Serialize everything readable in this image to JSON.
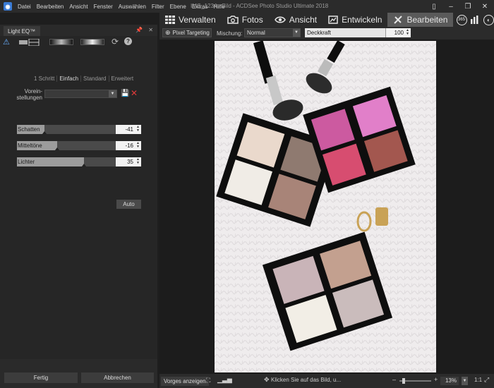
{
  "app": {
    "menu": [
      "Datei",
      "Bearbeiten",
      "Ansicht",
      "Fenster",
      "Auswählen",
      "Filter",
      "Ebene",
      "Extras",
      "Hilfe"
    ],
    "title": "IMG_1234 - Bild - ACDSee Photo Studio Ultimate 2018"
  },
  "modes": {
    "manage": "Verwalten",
    "photos": "Fotos",
    "view": "Ansicht",
    "develop": "Entwickeln",
    "edit": "Bearbeiten",
    "badge": "365"
  },
  "panel": {
    "tab_title": "Light EQ™",
    "mode_tabs": [
      "1 Schritt",
      "Einfach",
      "Standard",
      "Erweitert"
    ],
    "active_mode": "Einfach",
    "presets_label": "Vorein-\nstellungen",
    "presets_value": "",
    "sliders": [
      {
        "label": "Schatten",
        "value": "-41",
        "level": 0.28
      },
      {
        "label": "Mitteltöne",
        "value": "-16",
        "level": 0.41
      },
      {
        "label": "Lichter",
        "value": "35",
        "level": 0.675
      }
    ],
    "auto_label": "Auto",
    "done_label": "Fertig",
    "cancel_label": "Abbrechen"
  },
  "edit_toolbar": {
    "pixel_targeting": "Pixel Targeting",
    "blend_label": "Mischung:",
    "blend_value": "Normal",
    "opacity_label": "Deckkraft",
    "opacity_value": "100",
    "opacity_level": 1.0
  },
  "status": {
    "show_original": "Vorges anzeigen",
    "hint": "Klicken Sie auf das Bild, u...",
    "zoom": "13%",
    "zoom_fit": "1:1"
  },
  "colors": {
    "active_mode_bg": "#5a5a5a",
    "accent_blue": "#5aa0e8",
    "delete_red": "#e03a3a"
  }
}
